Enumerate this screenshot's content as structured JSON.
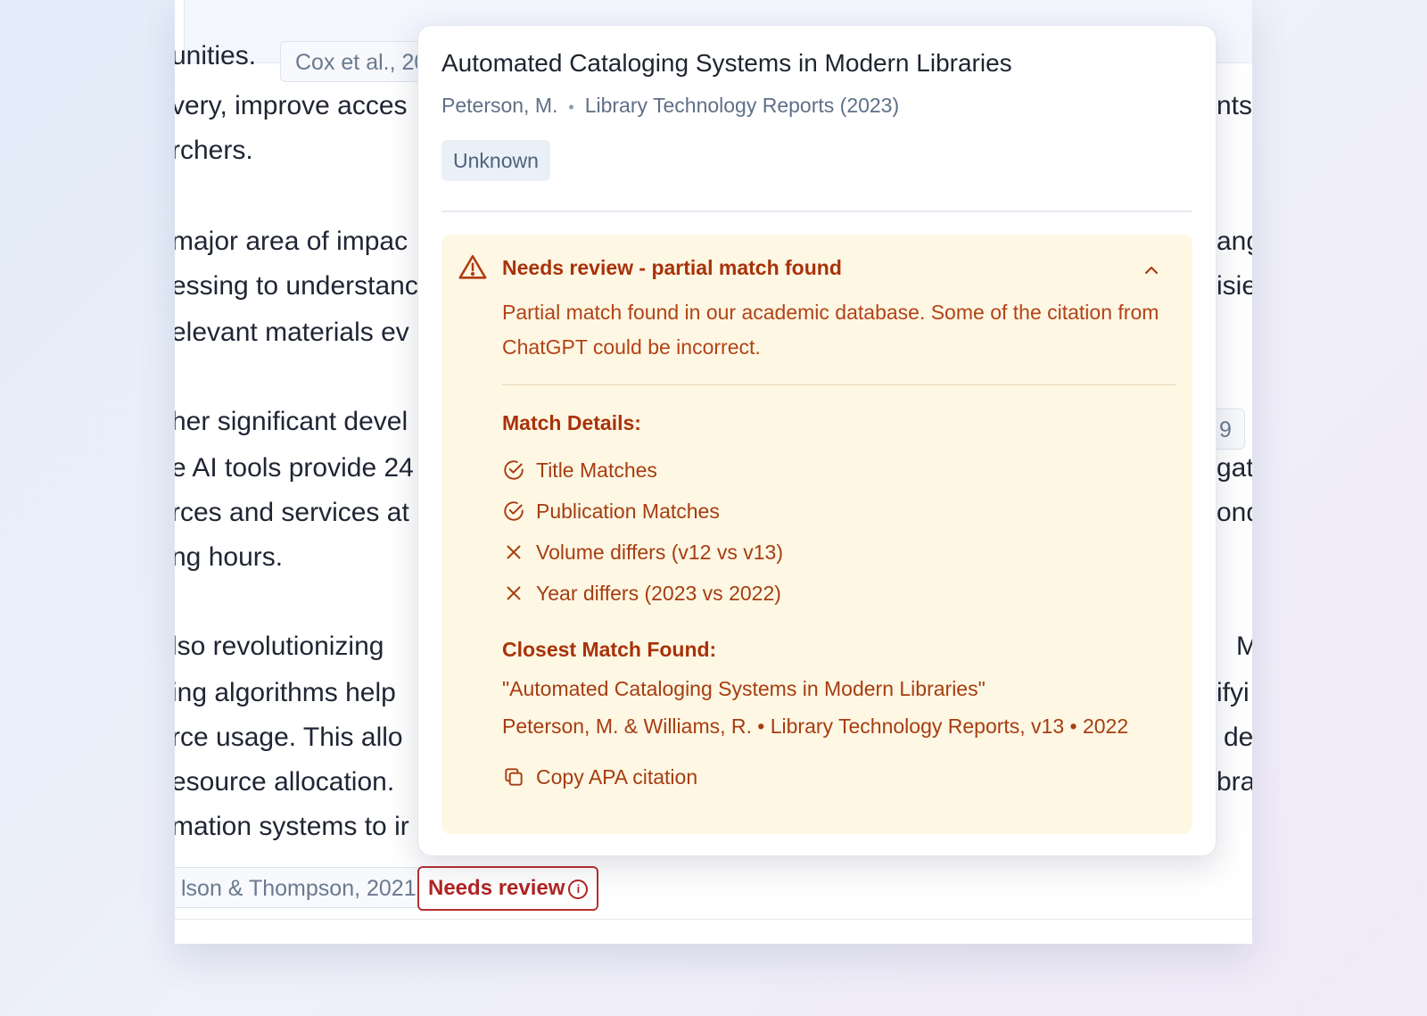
{
  "document": {
    "lines_left": [
      "unities.",
      "very, improve acces",
      "rchers.",
      "major area of impac",
      "essing to understanc",
      "elevant materials ev",
      "her significant devel",
      "e AI tools provide 24",
      "rces and services at",
      "ng hours.",
      "lso revolutionizing",
      "ing algorithms help",
      "rce usage. This allo",
      "esource allocation.",
      "mation systems to ir"
    ],
    "lines_right": [
      "nts",
      "ang",
      "isie",
      "gat",
      "ond",
      "M",
      "ifyi",
      "de",
      "bra"
    ],
    "citation_chips": {
      "top_left": "Cox et al., 20",
      "right_partial": "9",
      "bottom_left": "lson & Thompson, 2021"
    },
    "needs_review_chip": "Needs review",
    "info_glyph": "i"
  },
  "popover": {
    "title": "Automated Cataloging Systems in Modern Libraries",
    "author": "Peterson, M.",
    "separator": "•",
    "journal": "Library Technology Reports (2023)",
    "badge": "Unknown",
    "review": {
      "heading": "Needs review - partial match found",
      "description": "Partial match found in our academic database. Some of the citation from ChatGPT could be incorrect.",
      "match_details_label": "Match Details:",
      "matches": [
        {
          "status": "match",
          "icon": "check-circle-icon",
          "text": "Title Matches"
        },
        {
          "status": "match",
          "icon": "check-circle-icon",
          "text": "Publication Matches"
        },
        {
          "status": "mismatch",
          "icon": "x-icon",
          "text": "Volume differs (v12 vs v13)"
        },
        {
          "status": "mismatch",
          "icon": "x-icon",
          "text": "Year differs (2023 vs 2022)"
        }
      ],
      "closest_label": "Closest Match Found:",
      "closest_title": "\"Automated Cataloging Systems in Modern Libraries\"",
      "closest_meta": "Peterson, M. & Williams, R. • Library Technology Reports, v13 • 2022",
      "copy_label": "Copy APA citation"
    }
  },
  "colors": {
    "warning_bg": "#fef7e3",
    "warning_text": "#a8320a",
    "error_red": "#b02525",
    "muted_text": "#5e7088"
  }
}
